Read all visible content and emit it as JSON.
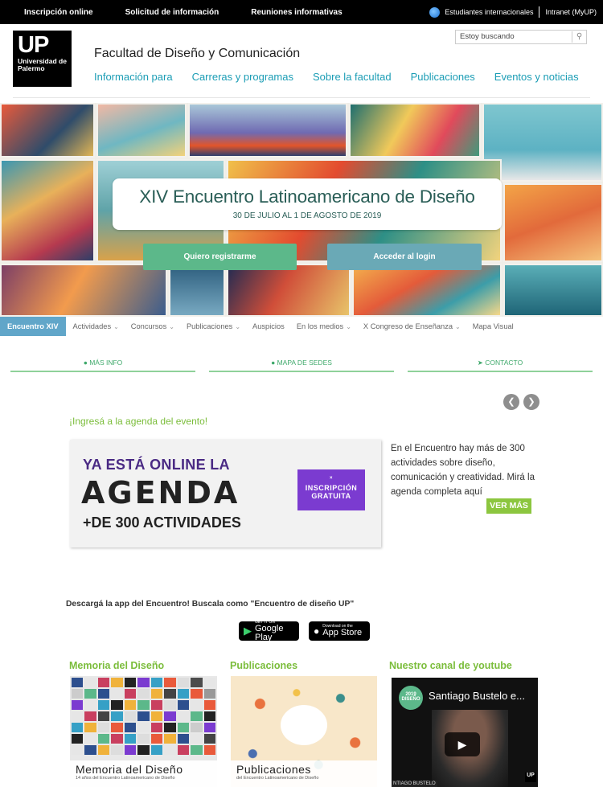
{
  "topbar": {
    "links": [
      "Inscripción online",
      "Solicitud de información",
      "Reuniones informativas"
    ],
    "intl": "Estudiantes internacionales",
    "intranet": "Intranet (MyUP)"
  },
  "header": {
    "logo_big": "UP",
    "logo_small": "Universidad de Palermo",
    "faculty": "Facultad de Diseño y Comunicación",
    "search_placeholder": "Estoy buscando",
    "nav": [
      "Información para",
      "Carreras y programas",
      "Sobre la facultad",
      "Publicaciones",
      "Eventos y noticias"
    ]
  },
  "banner": {
    "title": "XIV Encuentro Latinoamericano de Diseño",
    "dates": "30 DE JULIO AL 1 DE AGOSTO DE 2019",
    "btn_register": "Quiero registrarme",
    "btn_login": "Acceder al login"
  },
  "subnav": {
    "active": "Encuentro XIV",
    "items": [
      "Actividades",
      "Concursos",
      "Publicaciones",
      "Auspicios",
      "En los medios",
      "X Congreso de Enseñanza",
      "Mapa Visual"
    ]
  },
  "info_tabs": [
    "MÁS INFO",
    "MAPA DE SEDES",
    "CONTACTO"
  ],
  "agenda": {
    "title": "¡Ingresá a la agenda del evento!",
    "ad_line1": "YA ESTÁ ONLINE LA",
    "ad_line2": "AGENDA",
    "ad_line3": "+DE 300 ACTIVIDADES",
    "badge_line1": "INSCRIPCIÓN",
    "badge_line2": "GRATUITA",
    "text": "En el Encuentro hay más de 300 actividades sobre diseño, comunicación y creatividad. Mirá la agenda completa aquí",
    "more": "VER MÁS"
  },
  "app": {
    "line": "Descargá la app del Encuentro! Buscala como \"Encuentro de diseño UP\"",
    "google_small": "GET IT ON",
    "google_big": "Google Play",
    "apple_small": "Download on the",
    "apple_big": "App Store"
  },
  "sections": {
    "memoria_title": "Memoria del Diseño",
    "memoria_caption": "Memoria del Diseño",
    "memoria_sub": "14 años del Encuentro Latinoamericano de Diseño",
    "pub_title": "Publicaciones",
    "pub_caption": "Publicaciones",
    "pub_sub": "del Encuentro Latinoamericano de Diseño",
    "yt_title": "Nuestro canal de youtube",
    "video_title": "Santiago Bustelo e...",
    "video_badge": "2019 DISEÑO",
    "video_footer": "NTIAGO BUSTELO",
    "video_logo": "UP"
  }
}
